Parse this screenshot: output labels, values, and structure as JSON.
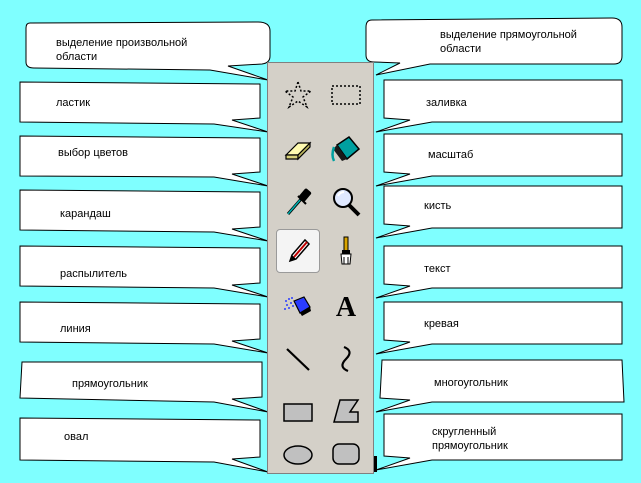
{
  "callouts": {
    "free_select": "выделение произвольной\nобласти",
    "eraser": "ластик",
    "pick_color": "выбор цветов",
    "pencil": "карандаш",
    "airbrush": "распылитель",
    "line": "линия",
    "rectangle": "прямоугольник",
    "ellipse": "овал",
    "rect_select": "выделение прямоугольной\nобласти",
    "fill": "заливка",
    "magnifier": "масштаб",
    "brush": "кисть",
    "text": "текст",
    "curve": "кревая",
    "polygon": "многоугольник",
    "rounded_rect": "скругленный\nпрямоугольник"
  },
  "toolbar": {
    "selected_tool": "pencil",
    "text_tool_glyph": "A"
  },
  "colors": {
    "background": "#7fffff",
    "toolbar": "#d4d0c8",
    "callout_fill": "#ffffff"
  }
}
